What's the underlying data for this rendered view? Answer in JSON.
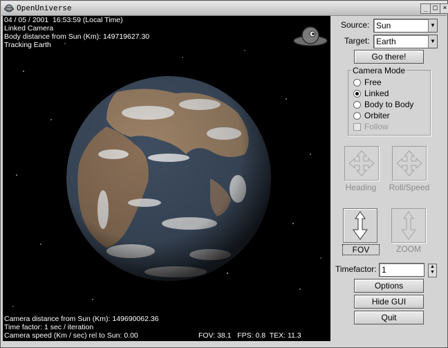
{
  "window": {
    "title": "OpenUniverse",
    "buttons": {
      "minimize": "_",
      "maximize": "□",
      "close": "×"
    }
  },
  "hud": {
    "datetime": "04 / 05 / 2001  16:53:59 (Local Time)",
    "camera_mode_line": "Linked Camera",
    "body_distance": "Body distance from Sun (Km): 149719627.30",
    "tracking": "Tracking Earth",
    "camera_distance": "Camera distance from Sun (Km): 149690062.36",
    "time_factor": "Time factor: 1 sec / iteration",
    "camera_speed": "Camera speed (Km / sec) rel to Sun: 0.00",
    "stats": "FOV: 38.1   FPS: 0.8  TEX: 11.3"
  },
  "panel": {
    "source_label": "Source:",
    "source_value": "Sun",
    "target_label": "Target:",
    "target_value": "Earth",
    "go_button": "Go there!",
    "camera_mode_title": "Camera Mode",
    "modes": [
      {
        "label": "Free",
        "selected": false
      },
      {
        "label": "Linked",
        "selected": true
      },
      {
        "label": "Body to Body",
        "selected": false
      },
      {
        "label": "Orbiter",
        "selected": false
      }
    ],
    "follow_label": "Follow",
    "heading_label": "Heading",
    "roll_speed_label": "Roll/Speed",
    "fov_label": "FOV",
    "zoom_label": "ZOOM",
    "timefactor_label": "Timefactor:",
    "timefactor_value": "1",
    "options_button": "Options",
    "hide_gui_button": "Hide GUI",
    "quit_button": "Quit"
  },
  "colors": {
    "panel_bg": "#d4d4d4",
    "viewport_bg": "#000000",
    "ocean": "#3e4d60",
    "land": "#9b8166",
    "cloud": "#e6e6e6"
  }
}
